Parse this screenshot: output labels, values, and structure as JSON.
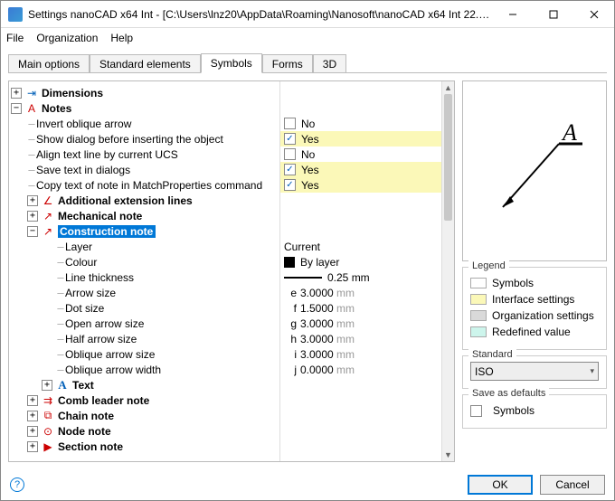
{
  "window": {
    "title": "Settings nanoCAD x64 Int - [C:\\Users\\lnz20\\AppData\\Roaming\\Nanosoft\\nanoCAD x64 Int 22.2\\en-US\\App..."
  },
  "menubar": {
    "file": "File",
    "organization": "Organization",
    "help": "Help"
  },
  "tabs": {
    "main": "Main options",
    "standard": "Standard elements",
    "symbols": "Symbols",
    "forms": "Forms",
    "threeD": "3D"
  },
  "tree": {
    "dimensions": "Dimensions",
    "notes": "Notes",
    "invert_oblique": "Invert oblique arrow",
    "show_dialog": "Show dialog before inserting the object",
    "align_text": "Align text line by current UCS",
    "save_text": "Save text in dialogs",
    "copy_text": "Copy text of note in MatchProperties command",
    "add_ext_lines": "Additional extension lines",
    "mech_note": "Mechanical note",
    "constr_note": "Construction note",
    "layer": "Layer",
    "colour": "Colour",
    "line_thickness": "Line thickness",
    "arrow_size": "Arrow size",
    "dot_size": "Dot size",
    "open_arrow": "Open arrow size",
    "half_arrow": "Half arrow size",
    "oblique_arrow_size": "Oblique arrow size",
    "oblique_arrow_width": "Oblique arrow width",
    "text": "Text",
    "comb_leader": "Comb leader note",
    "chain_note": "Chain note",
    "node_note": "Node note",
    "section_note": "Section note"
  },
  "values": {
    "no": "No",
    "yes": "Yes",
    "current": "Current",
    "by_layer": "By layer",
    "line_thick_val": "0.25 mm",
    "arrow_size_pref": "e",
    "arrow_size_val": "3.0000",
    "dot_size_pref": "f",
    "dot_size_val": "1.5000",
    "open_arrow_pref": "g",
    "open_arrow_val": "3.0000",
    "half_arrow_pref": "h",
    "half_arrow_val": "3.0000",
    "obl_arrow_size_pref": "i",
    "obl_arrow_size_val": "3.0000",
    "obl_arrow_width_pref": "j",
    "obl_arrow_width_val": "0.0000",
    "unit_mm": "mm"
  },
  "legend": {
    "title": "Legend",
    "symbols": "Symbols",
    "interface": "Interface settings",
    "organization": "Organization settings",
    "redefined": "Redefined value"
  },
  "standard": {
    "title": "Standard",
    "value": "ISO"
  },
  "save_defaults": {
    "title": "Save as defaults",
    "symbols": "Symbols"
  },
  "buttons": {
    "ok": "OK",
    "cancel": "Cancel"
  },
  "boxes": {
    "plus": "+",
    "minus": "−"
  }
}
